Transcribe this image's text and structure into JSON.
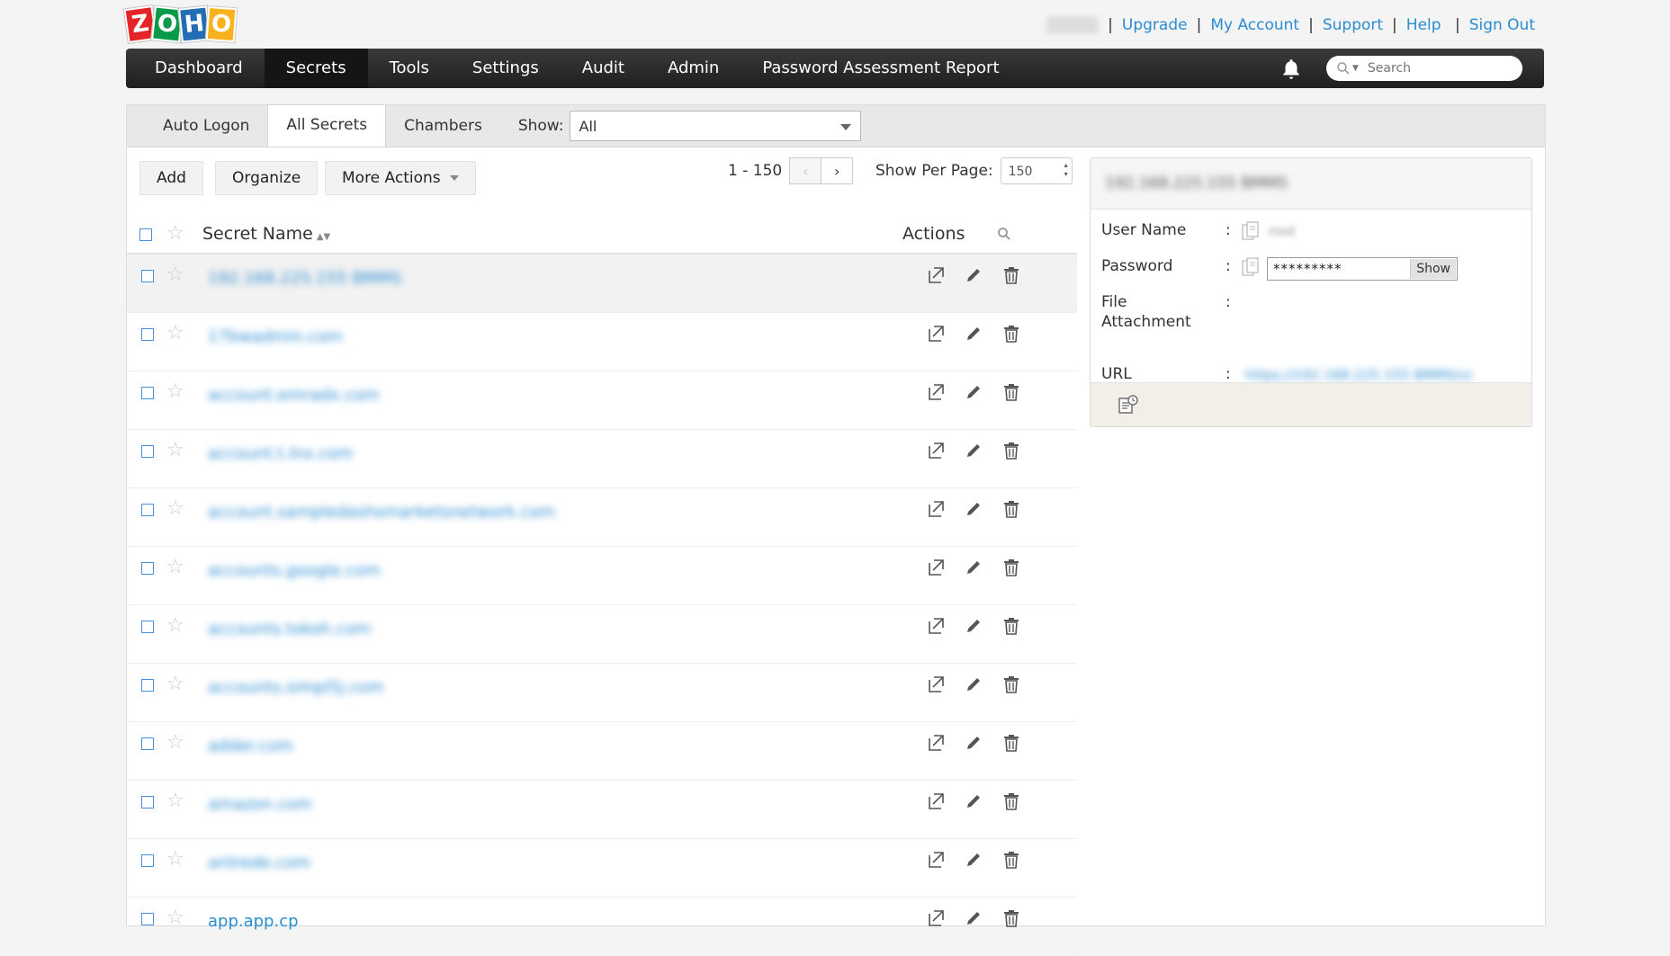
{
  "header": {
    "logo_letters": [
      "Z",
      "O",
      "H",
      "O"
    ],
    "links": [
      "Upgrade",
      "My Account",
      "Support",
      "Help",
      "Sign Out"
    ]
  },
  "nav": {
    "items": [
      "Dashboard",
      "Secrets",
      "Tools",
      "Settings",
      "Audit",
      "Admin",
      "Password Assessment Report"
    ],
    "active": "Secrets",
    "search_placeholder": "Search"
  },
  "tabs": {
    "items": [
      "Auto Logon",
      "All Secrets",
      "Chambers"
    ],
    "active": "All Secrets",
    "show_label": "Show:",
    "show_value": "All"
  },
  "toolbar": {
    "add_label": "Add",
    "organize_label": "Organize",
    "more_actions_label": "More Actions",
    "page_range": "1 - 150",
    "per_page_label": "Show Per Page:",
    "per_page_value": "150"
  },
  "table": {
    "col_name": "Secret Name",
    "col_actions": "Actions",
    "rows": [
      "192.168.225.155 BMMS",
      "17bwadmin.com",
      "account.emradx.com",
      "account.t.lnx.com",
      "account.sampledashsmarketsnetwork.com",
      "accounts.google.com",
      "accounts.tokoh.com",
      "accounts.simpl5j.com",
      "adder.com",
      "amazon.com",
      "antrede.com",
      "app.app.cp"
    ]
  },
  "detail": {
    "title": "192.168.225.155 BMMS",
    "user_name_label": "User Name",
    "user_name_value": "root",
    "password_label": "Password",
    "password_mask": "*********",
    "show_label": "Show",
    "file_label_1": "File",
    "file_label_2": "Attachment",
    "url_label": "URL",
    "url_value": "https://192.168.225.155 BMMS/ui",
    "colon": ":"
  },
  "colors": {
    "link": "#2a8cd2",
    "nav_bg": "#2b2b2b",
    "checkbox": "#4a90e2"
  }
}
